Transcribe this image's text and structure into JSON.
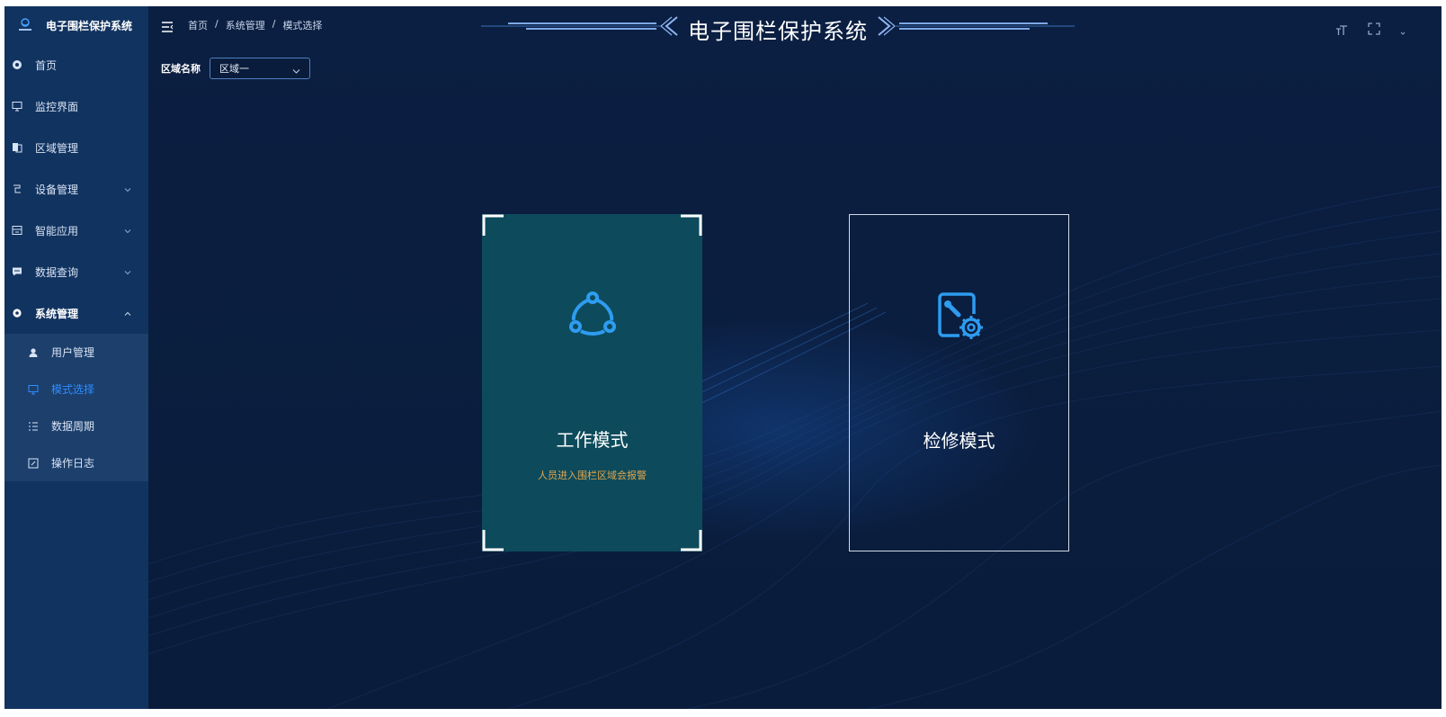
{
  "sidebar": {
    "brand_title": "电子围栏保护系统",
    "items": [
      {
        "label": "首页",
        "icon": "dashboard-icon"
      },
      {
        "label": "监控界面",
        "icon": "monitor-icon"
      },
      {
        "label": "区域管理",
        "icon": "copy-icon"
      },
      {
        "label": "设备管理",
        "icon": "device-icon"
      },
      {
        "label": "智能应用",
        "icon": "app-icon"
      },
      {
        "label": "数据查询",
        "icon": "chat-icon"
      },
      {
        "label": "系统管理",
        "icon": "gear-icon"
      }
    ],
    "subitems": [
      {
        "label": "用户管理",
        "icon": "user-icon"
      },
      {
        "label": "模式选择",
        "icon": "monitor-icon"
      },
      {
        "label": "数据周期",
        "icon": "list-icon"
      },
      {
        "label": "操作日志",
        "icon": "edit-icon"
      }
    ]
  },
  "header": {
    "breadcrumb": [
      "首页",
      "系统管理",
      "模式选择"
    ],
    "breadcrumb_separator": "/",
    "system_title": "电子围栏保护系统"
  },
  "filter": {
    "label": "区域名称",
    "selected": "区域一"
  },
  "cards": {
    "work": {
      "title": "工作模式",
      "desc": "人员进入围栏区域会报警"
    },
    "repair": {
      "title": "检修模式"
    }
  },
  "colors": {
    "accent": "#2e8cff",
    "sidebar_bg": "#113360",
    "main_bg": "#0a1c3b",
    "work_card_bg": "#0d4b5c",
    "warning_text": "#e6a54a"
  }
}
